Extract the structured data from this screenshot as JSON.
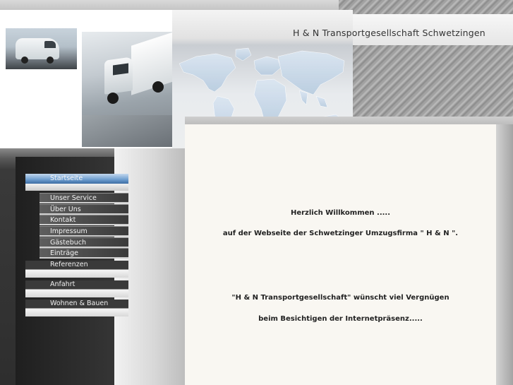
{
  "header": {
    "title": "H & N Transportgesellschaft  Schwetzingen"
  },
  "nav": {
    "items": [
      {
        "label": "Startseite"
      },
      {
        "label": "Unser Service"
      },
      {
        "label": "Über Uns"
      },
      {
        "label": "Kontakt"
      },
      {
        "label": "Impressum"
      },
      {
        "label": "Gästebuch"
      },
      {
        "label": "Einträge"
      },
      {
        "label": "Referenzen"
      },
      {
        "label": "Anfahrt"
      },
      {
        "label": "Wohnen & Bauen"
      }
    ]
  },
  "main": {
    "line1": "Herzlich Willkommen .....",
    "line2": "auf der Webseite der Schwetzinger Umzugsfirma \" H & N \".",
    "line3": "\"H & N Transportgesellschaft\" wünscht viel Vergnügen",
    "line4": "beim Besichtigen der Internetpräsenz....."
  },
  "colors": {
    "nav_active": "#5b8fc9",
    "content_bg": "#f9f7f2",
    "sidebar_dark": "#2e2e2e"
  }
}
